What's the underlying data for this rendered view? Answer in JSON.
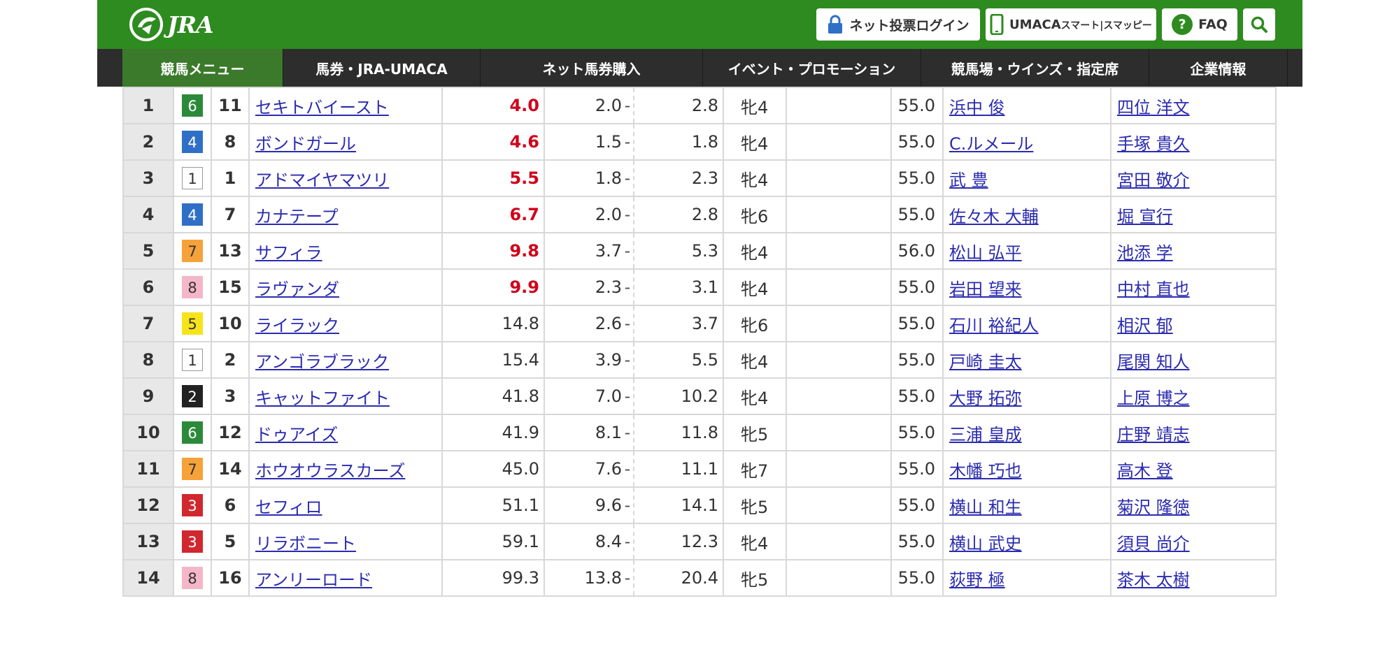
{
  "header": {
    "logo_text": "JRA",
    "login_label": "ネット投票ログイン",
    "umaca_label_main": "UMACA",
    "umaca_label_sub": "スマート|スマッピー",
    "faq_label": "FAQ",
    "brand_color": "#2e8b1f"
  },
  "nav": {
    "items": [
      {
        "label": "競馬メニュー"
      },
      {
        "label": "馬券・JRA-UMACA"
      },
      {
        "label": "ネット馬券購入"
      },
      {
        "label": "イベント・プロモーション"
      },
      {
        "label": "競馬場・ウインズ・指定席"
      },
      {
        "label": "企業情報"
      }
    ]
  },
  "waku_colors": {
    "1": {
      "bg": "#ffffff",
      "fg": "#333333",
      "border": "#999999"
    },
    "2": {
      "bg": "#222222",
      "fg": "#ffffff",
      "border": "#222222"
    },
    "3": {
      "bg": "#d0282e",
      "fg": "#ffffff",
      "border": "#d0282e"
    },
    "4": {
      "bg": "#2f6fc6",
      "fg": "#ffffff",
      "border": "#2f6fc6"
    },
    "5": {
      "bg": "#f7e31a",
      "fg": "#333333",
      "border": "#f7e31a"
    },
    "6": {
      "bg": "#2b8a3a",
      "fg": "#ffffff",
      "border": "#2b8a3a"
    },
    "7": {
      "bg": "#f5a23a",
      "fg": "#333333",
      "border": "#f5a23a"
    },
    "8": {
      "bg": "#f4b6c8",
      "fg": "#333333",
      "border": "#f4b6c8"
    }
  },
  "odds_highlight_color": "#d0021b",
  "rows": [
    {
      "rank": "1",
      "waku": "6",
      "umaban": "11",
      "name": "セキトバイースト",
      "odds": "4.0",
      "hot": true,
      "pmin": "2.0",
      "pmax": "2.8",
      "sex_age": "牝4",
      "weight": "55.0",
      "jockey": "浜中 俊",
      "trainer": "四位 洋文"
    },
    {
      "rank": "2",
      "waku": "4",
      "umaban": "8",
      "name": "ボンドガール",
      "odds": "4.6",
      "hot": true,
      "pmin": "1.5",
      "pmax": "1.8",
      "sex_age": "牝4",
      "weight": "55.0",
      "jockey": "C.ルメール",
      "trainer": "手塚 貴久"
    },
    {
      "rank": "3",
      "waku": "1",
      "umaban": "1",
      "name": "アドマイヤマツリ",
      "odds": "5.5",
      "hot": true,
      "pmin": "1.8",
      "pmax": "2.3",
      "sex_age": "牝4",
      "weight": "55.0",
      "jockey": "武 豊",
      "trainer": "宮田 敬介"
    },
    {
      "rank": "4",
      "waku": "4",
      "umaban": "7",
      "name": "カナテープ",
      "odds": "6.7",
      "hot": true,
      "pmin": "2.0",
      "pmax": "2.8",
      "sex_age": "牝6",
      "weight": "55.0",
      "jockey": "佐々木 大輔",
      "trainer": "堀 宣行"
    },
    {
      "rank": "5",
      "waku": "7",
      "umaban": "13",
      "name": "サフィラ",
      "odds": "9.8",
      "hot": true,
      "pmin": "3.7",
      "pmax": "5.3",
      "sex_age": "牝4",
      "weight": "56.0",
      "jockey": "松山 弘平",
      "trainer": "池添 学"
    },
    {
      "rank": "6",
      "waku": "8",
      "umaban": "15",
      "name": "ラヴァンダ",
      "odds": "9.9",
      "hot": true,
      "pmin": "2.3",
      "pmax": "3.1",
      "sex_age": "牝4",
      "weight": "55.0",
      "jockey": "岩田 望来",
      "trainer": "中村 直也"
    },
    {
      "rank": "7",
      "waku": "5",
      "umaban": "10",
      "name": "ライラック",
      "odds": "14.8",
      "hot": false,
      "pmin": "2.6",
      "pmax": "3.7",
      "sex_age": "牝6",
      "weight": "55.0",
      "jockey": "石川 裕紀人",
      "trainer": "相沢 郁"
    },
    {
      "rank": "8",
      "waku": "1",
      "umaban": "2",
      "name": "アンゴラブラック",
      "odds": "15.4",
      "hot": false,
      "pmin": "3.9",
      "pmax": "5.5",
      "sex_age": "牝4",
      "weight": "55.0",
      "jockey": "戸崎 圭太",
      "trainer": "尾関 知人"
    },
    {
      "rank": "9",
      "waku": "2",
      "umaban": "3",
      "name": "キャットファイト",
      "odds": "41.8",
      "hot": false,
      "pmin": "7.0",
      "pmax": "10.2",
      "sex_age": "牝4",
      "weight": "55.0",
      "jockey": "大野 拓弥",
      "trainer": "上原 博之"
    },
    {
      "rank": "10",
      "waku": "6",
      "umaban": "12",
      "name": "ドゥアイズ",
      "odds": "41.9",
      "hot": false,
      "pmin": "8.1",
      "pmax": "11.8",
      "sex_age": "牝5",
      "weight": "55.0",
      "jockey": "三浦 皇成",
      "trainer": "庄野 靖志"
    },
    {
      "rank": "11",
      "waku": "7",
      "umaban": "14",
      "name": "ホウオウラスカーズ",
      "odds": "45.0",
      "hot": false,
      "pmin": "7.6",
      "pmax": "11.1",
      "sex_age": "牝7",
      "weight": "55.0",
      "jockey": "木幡 巧也",
      "trainer": "高木 登"
    },
    {
      "rank": "12",
      "waku": "3",
      "umaban": "6",
      "name": "セフィロ",
      "odds": "51.1",
      "hot": false,
      "pmin": "9.6",
      "pmax": "14.1",
      "sex_age": "牝5",
      "weight": "55.0",
      "jockey": "横山 和生",
      "trainer": "菊沢 隆徳"
    },
    {
      "rank": "13",
      "waku": "3",
      "umaban": "5",
      "name": "リラボニート",
      "odds": "59.1",
      "hot": false,
      "pmin": "8.4",
      "pmax": "12.3",
      "sex_age": "牝4",
      "weight": "55.0",
      "jockey": "横山 武史",
      "trainer": "須貝 尚介"
    },
    {
      "rank": "14",
      "waku": "8",
      "umaban": "16",
      "name": "アンリーロード",
      "odds": "99.3",
      "hot": false,
      "pmin": "13.8",
      "pmax": "20.4",
      "sex_age": "牝5",
      "weight": "55.0",
      "jockey": "荻野 極",
      "trainer": "茶木 太樹"
    }
  ]
}
